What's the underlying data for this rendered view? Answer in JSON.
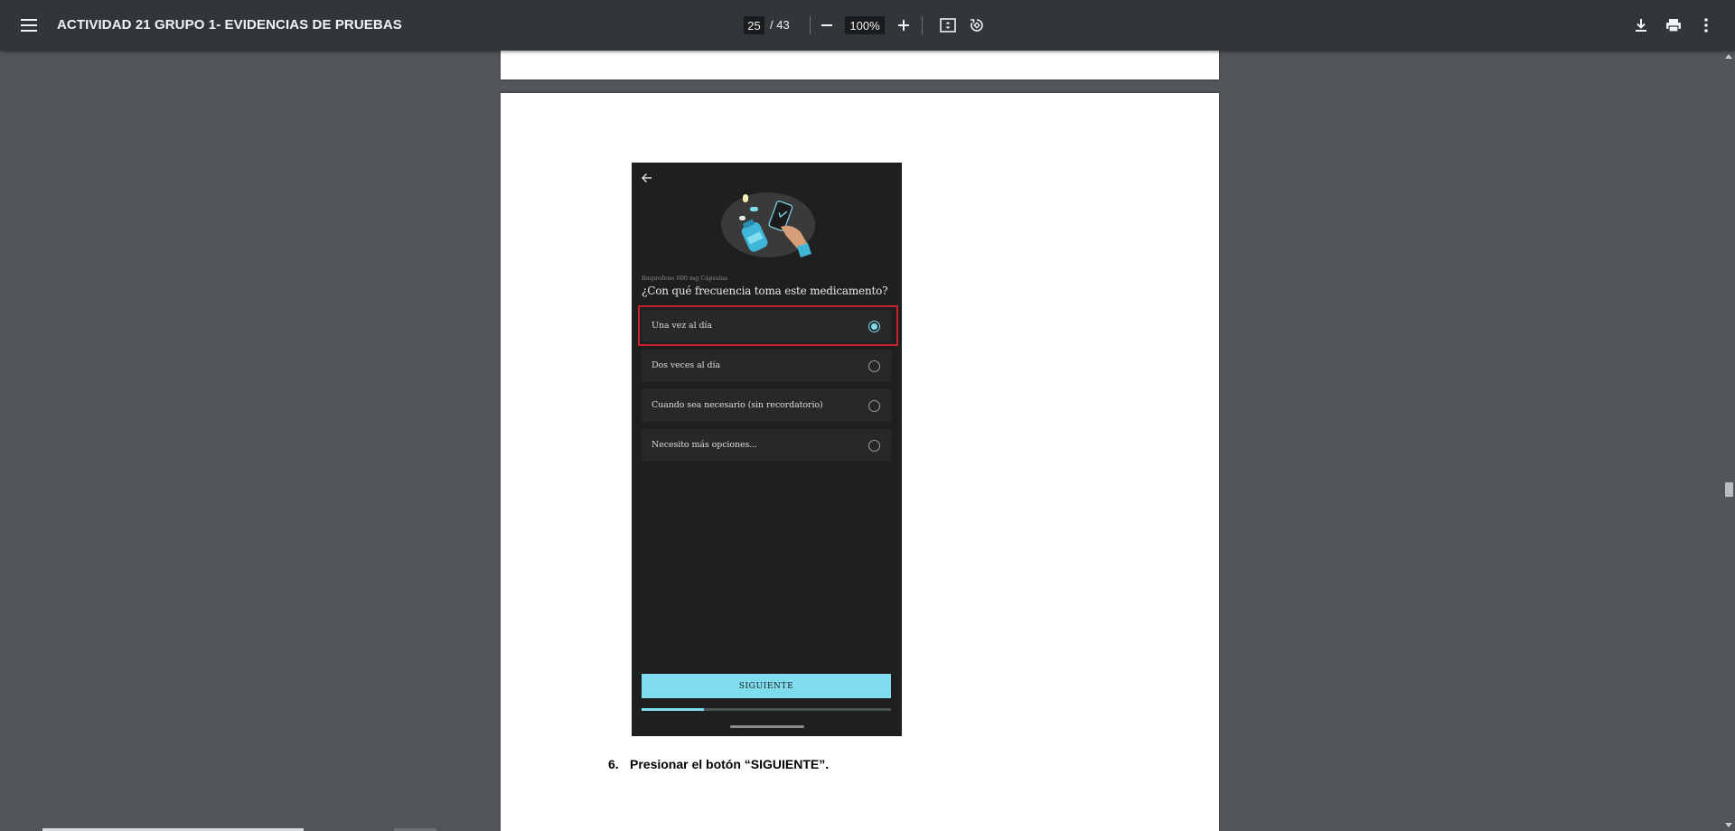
{
  "toolbar": {
    "title": "ACTIVIDAD 21 GRUPO 1- EVIDENCIAS DE PRUEBAS",
    "page_current": "25",
    "page_total": "/ 43",
    "zoom": "100%"
  },
  "phone": {
    "medication_name": "Ibuprofeno 600 mg Cápsulas",
    "question": "¿Con qué frecuencia toma este medicamento?",
    "options": [
      {
        "label": "Una vez al día",
        "selected": true
      },
      {
        "label": "Dos veces al día",
        "selected": false
      },
      {
        "label": "Cuando sea necesario (sin recordatorio)",
        "selected": false
      },
      {
        "label": "Necesito más opciones...",
        "selected": false
      }
    ],
    "next_button": "SIGUIENTE",
    "progress_fraction": 0.25
  },
  "document": {
    "step_number": "6.",
    "step_text": "Presionar el botón “SIGUIENTE”."
  },
  "colors": {
    "toolbar_bg": "#323639",
    "viewer_bg": "#525659",
    "accent": "#7fdcef",
    "highlight_border": "#c9202f",
    "phone_bg": "#1f1f1f"
  }
}
